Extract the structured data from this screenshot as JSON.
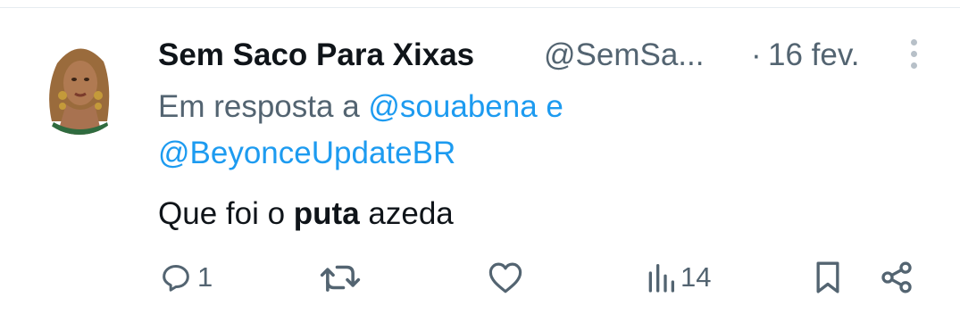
{
  "tweet": {
    "display_name": "Sem Saco Para Xixas",
    "handle": "@SemSa...",
    "separator": "·",
    "date": "16 fev.",
    "reply_prefix": "Em resposta a",
    "reply_mention_1": "@souabena",
    "reply_conjunction": "e",
    "reply_mention_2": "@BeyonceUpdateBR",
    "text_before": "Que foi o",
    "text_bold": "puta",
    "text_after": "azeda"
  },
  "actions": {
    "replies_count": "1",
    "views_count": "14"
  },
  "icons": {
    "avatar": "profile-photo",
    "more": "more-vertical-icon",
    "reply": "reply-icon",
    "retweet": "retweet-icon",
    "like": "heart-icon",
    "views": "views-icon",
    "bookmark": "bookmark-icon",
    "share": "share-icon"
  },
  "colors": {
    "link": "#1d9bf0",
    "secondary_text": "#536471",
    "primary_text": "#0f1419"
  }
}
